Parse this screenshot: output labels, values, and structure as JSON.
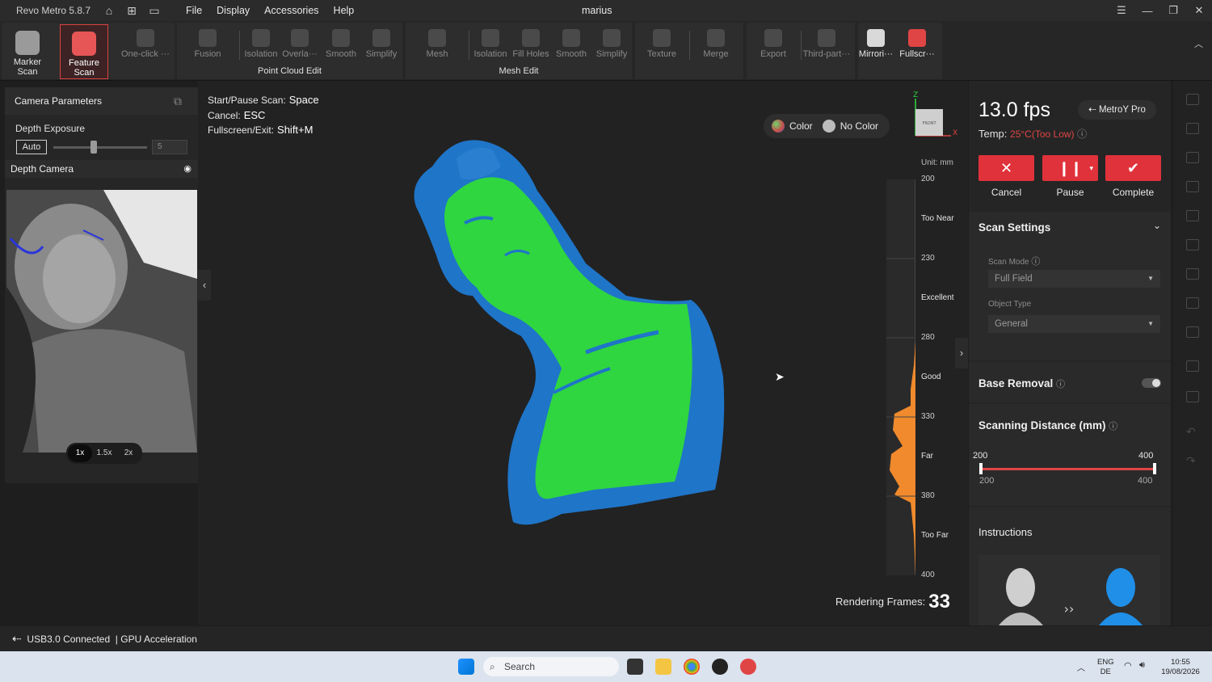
{
  "titlebar": {
    "app_name": "Revo Metro 5.8.7",
    "menu": [
      "File",
      "Display",
      "Accessories",
      "Help"
    ],
    "project": "marius"
  },
  "ribbon": {
    "scan_buttons": [
      {
        "label": "Marker Scan",
        "state": "normal"
      },
      {
        "label": "Feature Scan",
        "state": "active"
      }
    ],
    "tools": [
      "One-click ···"
    ],
    "point_cloud_edit": {
      "label": "Point Cloud Edit",
      "buttons": [
        "Fusion",
        "Isolation",
        "Overla···",
        "Smooth",
        "Simplify"
      ]
    },
    "mesh_edit": {
      "label": "Mesh Edit",
      "buttons": [
        "Mesh",
        "Isolation",
        "Fill Holes",
        "Smooth",
        "Simplify"
      ]
    },
    "other_buttons": [
      "Texture",
      "Merge",
      "Export",
      "Third-part···"
    ],
    "view_buttons": [
      "Mirrori···",
      "Fullscr···"
    ]
  },
  "left_panel": {
    "camera_parameters": "Camera Parameters",
    "depth_exposure": "Depth Exposure",
    "auto_label": "Auto",
    "exposure_value": "5",
    "depth_camera": "Depth Camera",
    "zoom_options": [
      "1x",
      "1.5x",
      "2x"
    ],
    "zoom_selected": "1x"
  },
  "viewport": {
    "shortcuts": [
      {
        "label": "Start/Pause Scan:",
        "key": "Space"
      },
      {
        "label": "Cancel:",
        "key": "ESC"
      },
      {
        "label": "Fullscreen/Exit:",
        "key": "Shift+M"
      }
    ],
    "color_toggle": {
      "color": "Color",
      "no_color": "No Color"
    },
    "axis_labels": {
      "z": "Z",
      "x": "X",
      "cube": "FRONT"
    },
    "unit": "Unit: mm",
    "distance_ticks": [
      "200",
      "230",
      "280",
      "330",
      "380",
      "400"
    ],
    "distance_zones": [
      "Too Near",
      "Excellent",
      "Good",
      "Far",
      "Too Far"
    ],
    "rendering_frames_label": "Rendering Frames:",
    "rendering_frames_value": "33",
    "colors": {
      "scan_green": "#2fd640",
      "scan_blue": "#1f75c8",
      "histogram": "#f08a2c"
    }
  },
  "right_panel": {
    "fps": "13.0 fps",
    "device": "MetroY Pro",
    "temp_label": "Temp:",
    "temp_value": "25°C(Too Low)",
    "actions": {
      "cancel": "Cancel",
      "pause": "Pause",
      "complete": "Complete"
    },
    "scan_settings": "Scan Settings",
    "scan_mode_label": "Scan Mode",
    "scan_mode_value": "Full Field",
    "object_type_label": "Object Type",
    "object_type_value": "General",
    "base_removal": "Base Removal",
    "base_removal_on": false,
    "scanning_distance": "Scanning Distance (mm)",
    "distance_min": "200",
    "distance_max": "400",
    "distance_low": "200",
    "distance_high": "400",
    "instructions": "Instructions",
    "accent": "#e0323b"
  },
  "statusbar": {
    "connection": "USB3.0 Connected",
    "gpu": "GPU Acceleration"
  },
  "taskbar": {
    "search_placeholder": "Search",
    "lang_top": "ENG",
    "lang_bottom": "DE",
    "time": "10:55",
    "date": "19/08/2026"
  }
}
